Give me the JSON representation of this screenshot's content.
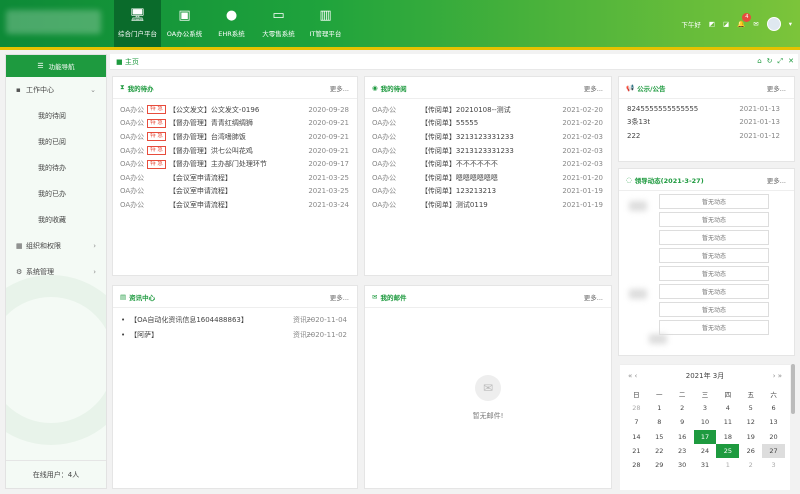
{
  "nav": [
    {
      "label": "综合门户平台",
      "icon": "monitor-icon",
      "active": true
    },
    {
      "label": "OA办公系统",
      "icon": "oa-icon"
    },
    {
      "label": "EHR系统",
      "icon": "user-icon"
    },
    {
      "label": "大零售系统",
      "icon": "card-icon"
    },
    {
      "label": "IT管理平台",
      "icon": "chart-bars-icon"
    }
  ],
  "topbar": {
    "greeting": "下午好",
    "notif_count": "4"
  },
  "sidebar": {
    "header": "功能导航",
    "groups": [
      {
        "label": "工作中心",
        "icon": "briefcase-icon",
        "chevron": "⌄",
        "children": [
          "我的待阅",
          "我的已阅",
          "我的待办",
          "我的已办",
          "我的收藏"
        ]
      },
      {
        "label": "组织和权限",
        "icon": "grid-icon",
        "chevron": "›"
      },
      {
        "label": "系统管理",
        "icon": "gears-icon",
        "chevron": "›"
      }
    ],
    "online": "在线用户：4人"
  },
  "breadcrumb": "主页",
  "todo": {
    "title": "我的待办",
    "more": "更多...",
    "rows": [
      {
        "src": "OA办公",
        "tag": "特 急",
        "title": "【公文发文】公文发文-0196",
        "date": "2020-09-28"
      },
      {
        "src": "OA办公",
        "tag": "特 急",
        "title": "【督办管理】青青红绸绸狮",
        "date": "2020-09-21"
      },
      {
        "src": "OA办公",
        "tag": "特 急",
        "title": "【督办管理】台湾嗜肺饭",
        "date": "2020-09-21"
      },
      {
        "src": "OA办公",
        "tag": "特 急",
        "title": "【督办管理】洪七公叫花鸡",
        "date": "2020-09-21"
      },
      {
        "src": "OA办公",
        "tag": "特 急",
        "title": "【督办管理】主办部门处理环节",
        "date": "2020-09-17"
      },
      {
        "src": "OA办公",
        "tag": "",
        "title": "【会议室申请流程】",
        "date": "2021-03-25"
      },
      {
        "src": "OA办公",
        "tag": "",
        "title": "【会议室申请流程】",
        "date": "2021-03-25"
      },
      {
        "src": "OA办公",
        "tag": "",
        "title": "【会议室申请流程】",
        "date": "2021-03-24"
      }
    ]
  },
  "toread": {
    "title": "我的待阅",
    "more": "更多...",
    "rows": [
      {
        "src": "OA办公",
        "tag": "",
        "title": "【传阅单】20210108--测试",
        "date": "2021-02-20"
      },
      {
        "src": "OA办公",
        "tag": "",
        "title": "【传阅单】55555",
        "date": "2021-02-20"
      },
      {
        "src": "OA办公",
        "tag": "",
        "title": "【传阅单】3213123331233",
        "date": "2021-02-03"
      },
      {
        "src": "OA办公",
        "tag": "",
        "title": "【传阅单】3213123331233",
        "date": "2021-02-03"
      },
      {
        "src": "OA办公",
        "tag": "",
        "title": "【传阅单】不不不不不不",
        "date": "2021-02-03"
      },
      {
        "src": "OA办公",
        "tag": "",
        "title": "【传阅单】嗯嗯嗯嗯嗯嗯",
        "date": "2021-01-20"
      },
      {
        "src": "OA办公",
        "tag": "",
        "title": "【传阅单】123213213",
        "date": "2021-01-19"
      },
      {
        "src": "OA办公",
        "tag": "",
        "title": "【传阅单】测试0119",
        "date": "2021-01-19"
      }
    ]
  },
  "notice": {
    "title": "公示/公告",
    "more": "更多...",
    "rows": [
      {
        "title": "8245555555555555",
        "date": "2021-01-13"
      },
      {
        "title": "3条13t",
        "date": "2021-01-13"
      },
      {
        "title": "222",
        "date": "2021-01-12"
      }
    ]
  },
  "leader": {
    "title": "领导动态(2021-3-27)",
    "more": "更多...",
    "items": [
      "暂无动态",
      "暂无动态",
      "暂无动态",
      "暂无动态",
      "暂无动态",
      "暂无动态",
      "暂无动态",
      "暂无动态"
    ]
  },
  "info": {
    "title": "资讯中心",
    "more": "更多...",
    "rows": [
      {
        "title": "【OA自动化资讯信息1604488863】",
        "by": "资讯一",
        "date": "2020-11-04"
      },
      {
        "title": "【阿萨】",
        "by": "资讯一",
        "date": "2020-11-02"
      }
    ]
  },
  "mail": {
    "title": "我的邮件",
    "more": "更多...",
    "empty": "暂无邮件!"
  },
  "calendar": {
    "header": "2021年  3月",
    "prev": "« ‹",
    "next": "› »",
    "weekdays": [
      "日",
      "一",
      "二",
      "三",
      "四",
      "五",
      "六"
    ],
    "days": [
      {
        "d": "28",
        "o": true
      },
      {
        "d": "1"
      },
      {
        "d": "2"
      },
      {
        "d": "3"
      },
      {
        "d": "4"
      },
      {
        "d": "5"
      },
      {
        "d": "6"
      },
      {
        "d": "7"
      },
      {
        "d": "8"
      },
      {
        "d": "9"
      },
      {
        "d": "10"
      },
      {
        "d": "11"
      },
      {
        "d": "12"
      },
      {
        "d": "13"
      },
      {
        "d": "14"
      },
      {
        "d": "15"
      },
      {
        "d": "16"
      },
      {
        "d": "17",
        "today": true
      },
      {
        "d": "18"
      },
      {
        "d": "19"
      },
      {
        "d": "20"
      },
      {
        "d": "21"
      },
      {
        "d": "22"
      },
      {
        "d": "23"
      },
      {
        "d": "24"
      },
      {
        "d": "25",
        "today": true
      },
      {
        "d": "26"
      },
      {
        "d": "27",
        "sel": true
      },
      {
        "d": "28"
      },
      {
        "d": "29"
      },
      {
        "d": "30"
      },
      {
        "d": "31"
      },
      {
        "d": "1",
        "o": true
      },
      {
        "d": "2",
        "o": true
      },
      {
        "d": "3",
        "o": true
      }
    ]
  },
  "colors": {
    "primary": "#1e9a3f",
    "urgent": "#e74c3c",
    "accent_line": "#e6c200"
  }
}
